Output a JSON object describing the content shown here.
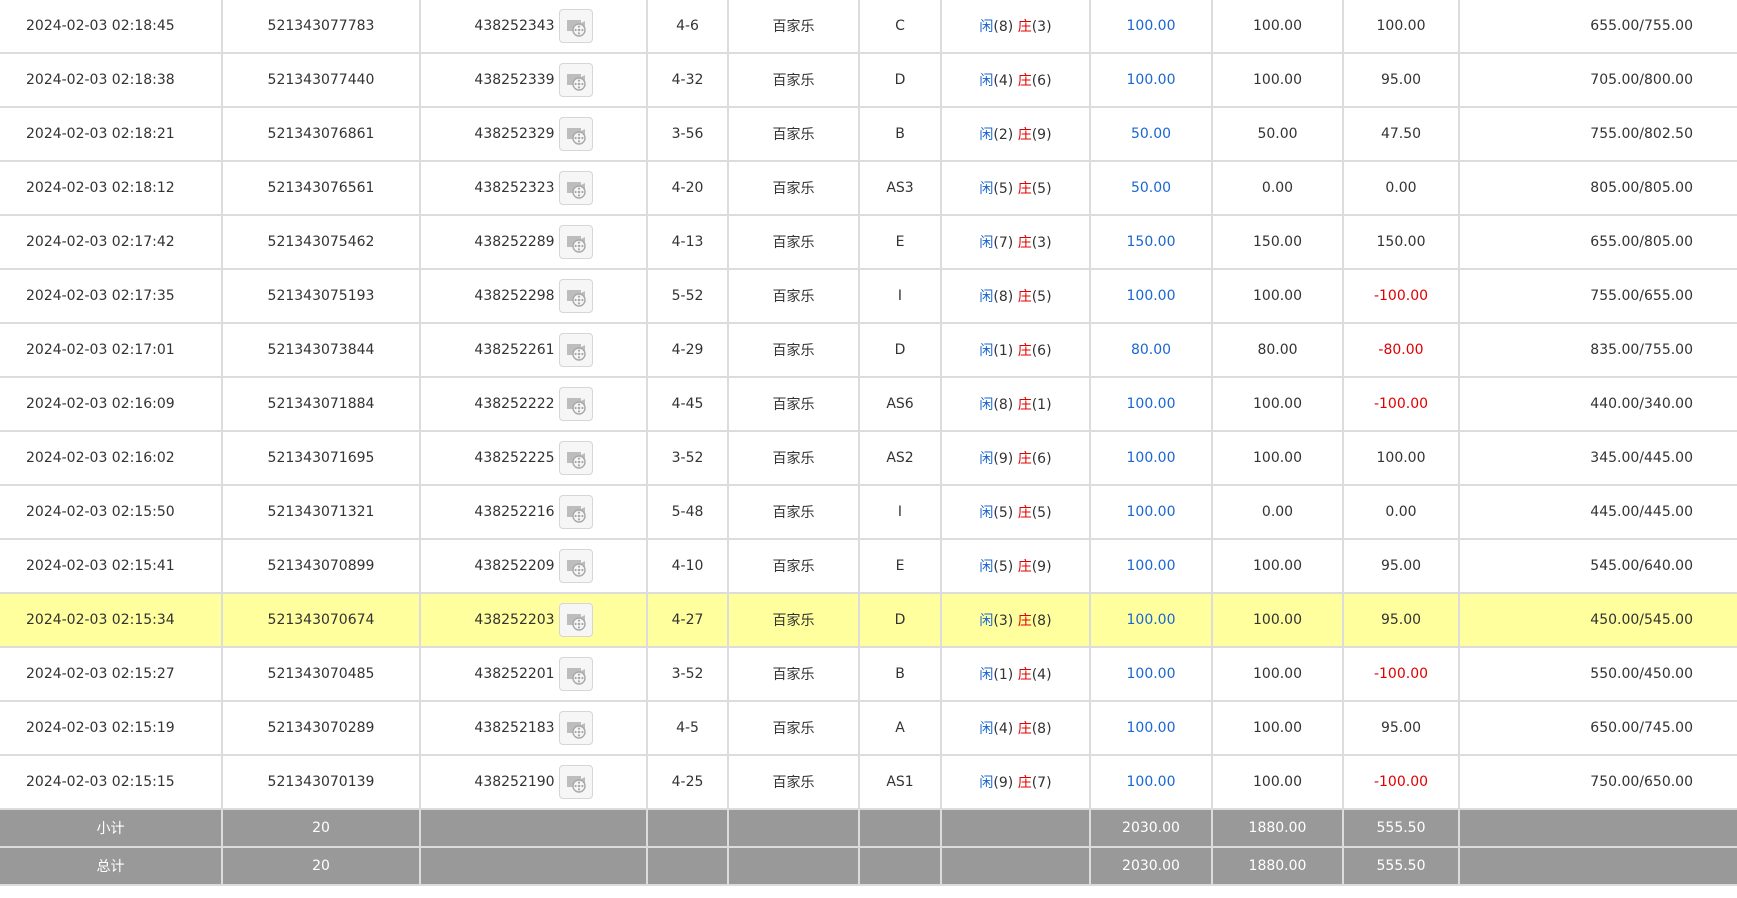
{
  "rows": [
    {
      "time": "2024-02-03 02:18:45",
      "order_no": "521343077783",
      "table_no": "438252343",
      "round": "4-6",
      "game": "百家乐",
      "seat": "C",
      "player_label": "闲",
      "player_score": "(8)",
      "banker_label": "庄",
      "banker_score": "(3)",
      "bet": "100.00",
      "valid_bet": "100.00",
      "win_loss": "100.00",
      "balance": "655.00/755.00"
    },
    {
      "time": "2024-02-03 02:18:38",
      "order_no": "521343077440",
      "table_no": "438252339",
      "round": "4-32",
      "game": "百家乐",
      "seat": "D",
      "player_label": "闲",
      "player_score": "(4)",
      "banker_label": "庄",
      "banker_score": "(6)",
      "bet": "100.00",
      "valid_bet": "100.00",
      "win_loss": "95.00",
      "balance": "705.00/800.00"
    },
    {
      "time": "2024-02-03 02:18:21",
      "order_no": "521343076861",
      "table_no": "438252329",
      "round": "3-56",
      "game": "百家乐",
      "seat": "B",
      "player_label": "闲",
      "player_score": "(2)",
      "banker_label": "庄",
      "banker_score": "(9)",
      "bet": "50.00",
      "valid_bet": "50.00",
      "win_loss": "47.50",
      "balance": "755.00/802.50"
    },
    {
      "time": "2024-02-03 02:18:12",
      "order_no": "521343076561",
      "table_no": "438252323",
      "round": "4-20",
      "game": "百家乐",
      "seat": "AS3",
      "player_label": "闲",
      "player_score": "(5)",
      "banker_label": "庄",
      "banker_score": "(5)",
      "bet": "50.00",
      "valid_bet": "0.00",
      "win_loss": "0.00",
      "balance": "805.00/805.00"
    },
    {
      "time": "2024-02-03 02:17:42",
      "order_no": "521343075462",
      "table_no": "438252289",
      "round": "4-13",
      "game": "百家乐",
      "seat": "E",
      "player_label": "闲",
      "player_score": "(7)",
      "banker_label": "庄",
      "banker_score": "(3)",
      "bet": "150.00",
      "valid_bet": "150.00",
      "win_loss": "150.00",
      "balance": "655.00/805.00"
    },
    {
      "time": "2024-02-03 02:17:35",
      "order_no": "521343075193",
      "table_no": "438252298",
      "round": "5-52",
      "game": "百家乐",
      "seat": "I",
      "player_label": "闲",
      "player_score": "(8)",
      "banker_label": "庄",
      "banker_score": "(5)",
      "bet": "100.00",
      "valid_bet": "100.00",
      "win_loss": "-100.00",
      "balance": "755.00/655.00"
    },
    {
      "time": "2024-02-03 02:17:01",
      "order_no": "521343073844",
      "table_no": "438252261",
      "round": "4-29",
      "game": "百家乐",
      "seat": "D",
      "player_label": "闲",
      "player_score": "(1)",
      "banker_label": "庄",
      "banker_score": "(6)",
      "bet": "80.00",
      "valid_bet": "80.00",
      "win_loss": "-80.00",
      "balance": "835.00/755.00"
    },
    {
      "time": "2024-02-03 02:16:09",
      "order_no": "521343071884",
      "table_no": "438252222",
      "round": "4-45",
      "game": "百家乐",
      "seat": "AS6",
      "player_label": "闲",
      "player_score": "(8)",
      "banker_label": "庄",
      "banker_score": "(1)",
      "bet": "100.00",
      "valid_bet": "100.00",
      "win_loss": "-100.00",
      "balance": "440.00/340.00"
    },
    {
      "time": "2024-02-03 02:16:02",
      "order_no": "521343071695",
      "table_no": "438252225",
      "round": "3-52",
      "game": "百家乐",
      "seat": "AS2",
      "player_label": "闲",
      "player_score": "(9)",
      "banker_label": "庄",
      "banker_score": "(6)",
      "bet": "100.00",
      "valid_bet": "100.00",
      "win_loss": "100.00",
      "balance": "345.00/445.00"
    },
    {
      "time": "2024-02-03 02:15:50",
      "order_no": "521343071321",
      "table_no": "438252216",
      "round": "5-48",
      "game": "百家乐",
      "seat": "I",
      "player_label": "闲",
      "player_score": "(5)",
      "banker_label": "庄",
      "banker_score": "(5)",
      "bet": "100.00",
      "valid_bet": "0.00",
      "win_loss": "0.00",
      "balance": "445.00/445.00"
    },
    {
      "time": "2024-02-03 02:15:41",
      "order_no": "521343070899",
      "table_no": "438252209",
      "round": "4-10",
      "game": "百家乐",
      "seat": "E",
      "player_label": "闲",
      "player_score": "(5)",
      "banker_label": "庄",
      "banker_score": "(9)",
      "bet": "100.00",
      "valid_bet": "100.00",
      "win_loss": "95.00",
      "balance": "545.00/640.00"
    },
    {
      "time": "2024-02-03 02:15:34",
      "order_no": "521343070674",
      "table_no": "438252203",
      "round": "4-27",
      "game": "百家乐",
      "seat": "D",
      "player_label": "闲",
      "player_score": "(3)",
      "banker_label": "庄",
      "banker_score": "(8)",
      "bet": "100.00",
      "valid_bet": "100.00",
      "win_loss": "95.00",
      "balance": "450.00/545.00",
      "highlight": true
    },
    {
      "time": "2024-02-03 02:15:27",
      "order_no": "521343070485",
      "table_no": "438252201",
      "round": "3-52",
      "game": "百家乐",
      "seat": "B",
      "player_label": "闲",
      "player_score": "(1)",
      "banker_label": "庄",
      "banker_score": "(4)",
      "bet": "100.00",
      "valid_bet": "100.00",
      "win_loss": "-100.00",
      "balance": "550.00/450.00"
    },
    {
      "time": "2024-02-03 02:15:19",
      "order_no": "521343070289",
      "table_no": "438252183",
      "round": "4-5",
      "game": "百家乐",
      "seat": "A",
      "player_label": "闲",
      "player_score": "(4)",
      "banker_label": "庄",
      "banker_score": "(8)",
      "bet": "100.00",
      "valid_bet": "100.00",
      "win_loss": "95.00",
      "balance": "650.00/745.00"
    },
    {
      "time": "2024-02-03 02:15:15",
      "order_no": "521343070139",
      "table_no": "438252190",
      "round": "4-25",
      "game": "百家乐",
      "seat": "AS1",
      "player_label": "闲",
      "player_score": "(9)",
      "banker_label": "庄",
      "banker_score": "(7)",
      "bet": "100.00",
      "valid_bet": "100.00",
      "win_loss": "-100.00",
      "balance": "750.00/650.00"
    }
  ],
  "subtotal": {
    "label": "小计",
    "count": "20",
    "bet": "2030.00",
    "valid_bet": "1880.00",
    "win_loss": "555.50"
  },
  "total": {
    "label": "总计",
    "count": "20",
    "bet": "2030.00",
    "valid_bet": "1880.00",
    "win_loss": "555.50"
  },
  "colors": {
    "blue": "#1a66d2",
    "red": "#e00000",
    "highlight": "#ffff9e",
    "footer": "#999999"
  },
  "icons": {
    "video": "video-replay-icon"
  }
}
